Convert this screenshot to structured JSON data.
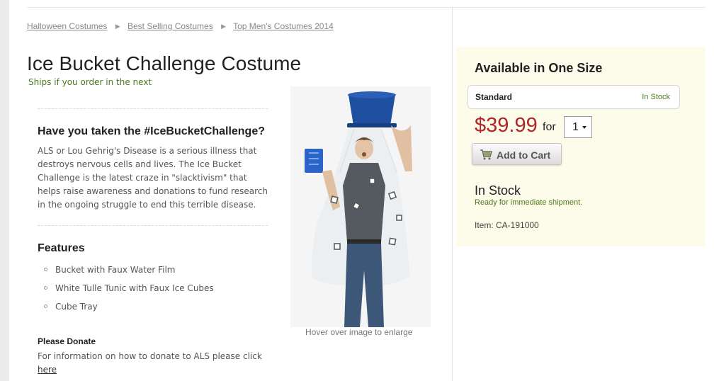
{
  "breadcrumb": {
    "items": [
      "Halloween Costumes",
      "Best Selling Costumes",
      "Top Men's Costumes 2014"
    ],
    "separator": "▶"
  },
  "product": {
    "title": "Ice Bucket Challenge Costume",
    "ships_text": "Ships if you order in the next",
    "description_heading": "Have you taken the #IceBucketChallenge?",
    "description": "ALS or Lou Gehrig's Disease is a serious illness that destroys nervous cells and lives. The Ice Bucket Challenge is the latest craze in \"slacktivism\" that helps raise awareness and donations to fund research in the ongoing struggle to end this terrible disease.",
    "features_heading": "Features",
    "features": [
      "Bucket with Faux Water Film",
      "White Tulle Tunic with Faux Ice Cubes",
      "Cube Tray"
    ],
    "donate_heading": "Please Donate",
    "donate_text": "For information on how to donate to ALS please click",
    "donate_link": "here",
    "image_hint": "Hover over image to enlarge"
  },
  "purchase": {
    "size_heading": "Available in One Size",
    "size_name": "Standard",
    "size_stock": "In Stock",
    "price": "$39.99",
    "for_label": "for",
    "quantity": "1",
    "add_to_cart": "Add to Cart",
    "stock_heading": "In Stock",
    "stock_sub": "Ready for immediate shipment.",
    "item_number": "Item: CA-191000"
  },
  "colors": {
    "price": "#b2252b",
    "in_stock_green": "#4a7a1a",
    "panel_bg": "#fdfbea",
    "bucket_blue": "#1f4fa0"
  },
  "icons": {
    "breadcrumb_separator": "triangle-right-icon",
    "add_to_cart": "shopping-cart-icon",
    "feature_bullet": "circle-bullet-icon",
    "qty_dropdown": "chevron-down-icon"
  }
}
